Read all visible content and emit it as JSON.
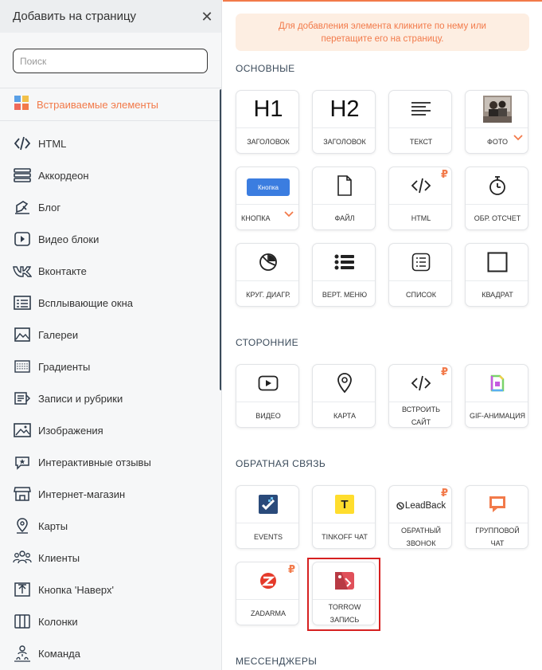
{
  "left_panel": {
    "title": "Добавить на страницу",
    "search_placeholder": "Поиск",
    "embedded_label": "Встраиваемые элементы",
    "items": [
      {
        "label": "HTML",
        "icon": "code-icon"
      },
      {
        "label": "Аккордеон",
        "icon": "accordion-icon"
      },
      {
        "label": "Блог",
        "icon": "blog-icon"
      },
      {
        "label": "Видео блоки",
        "icon": "video-icon"
      },
      {
        "label": "Вконтакте",
        "icon": "vk-icon"
      },
      {
        "label": "Всплывающие окна",
        "icon": "popup-icon"
      },
      {
        "label": "Галереи",
        "icon": "gallery-icon"
      },
      {
        "label": "Градиенты",
        "icon": "gradient-icon"
      },
      {
        "label": "Записи и рубрики",
        "icon": "posts-icon"
      },
      {
        "label": "Изображения",
        "icon": "image-icon"
      },
      {
        "label": "Интерактивные отзывы",
        "icon": "reviews-icon"
      },
      {
        "label": "Интернет-магазин",
        "icon": "shop-icon"
      },
      {
        "label": "Карты",
        "icon": "map-pin-icon"
      },
      {
        "label": "Клиенты",
        "icon": "clients-icon"
      },
      {
        "label": "Кнопка 'Наверх'",
        "icon": "scroll-top-icon"
      },
      {
        "label": "Колонки",
        "icon": "columns-icon"
      },
      {
        "label": "Команда",
        "icon": "team-icon"
      }
    ]
  },
  "right_panel": {
    "hint": "Для добавления элемента кликните по нему или перетащите его на страницу.",
    "sections": {
      "basic": "ОСНОВНЫЕ",
      "third_party": "СТОРОННИЕ",
      "feedback": "ОБРАТНАЯ СВЯЗЬ",
      "messengers": "МЕССЕНДЖЕРЫ"
    },
    "basic_cards": {
      "h1": {
        "icon_text": "H1",
        "label": "ЗАГОЛОВОК"
      },
      "h2": {
        "icon_text": "H2",
        "label": "ЗАГОЛОВОК"
      },
      "text": {
        "label": "ТЕКСТ"
      },
      "photo": {
        "label": "ФОТО"
      },
      "button": {
        "button_text": "Кнопка",
        "label": "КНОПКА"
      },
      "file": {
        "label": "ФАЙЛ"
      },
      "html": {
        "label": "HTML",
        "badge": "₽"
      },
      "countdown": {
        "label": "ОБР. ОТСЧЕТ"
      },
      "pie": {
        "label": "КРУГ. ДИАГР."
      },
      "vmenu": {
        "label": "ВЕРТ. МЕНЮ"
      },
      "list": {
        "label": "СПИСОК"
      },
      "square": {
        "label": "КВАДРАТ"
      }
    },
    "third_party_cards": {
      "video": {
        "label": "ВИДЕО"
      },
      "map": {
        "label": "КАРТА"
      },
      "embed": {
        "label": "ВСТРОИТЬ САЙТ",
        "badge": "₽"
      },
      "gif": {
        "label": "GIF-АНИМАЦИЯ"
      }
    },
    "feedback_cards": {
      "events": {
        "label": "EVENTS"
      },
      "tinkoff": {
        "label": "TINKOFF ЧАТ",
        "logo_text": "T"
      },
      "leadback": {
        "label": "ОБРАТНЫЙ ЗВОНОК",
        "logo_text": "LeadBack",
        "badge": "₽"
      },
      "group_chat": {
        "label": "ГРУППОВОЙ ЧАТ"
      },
      "zadarma": {
        "label": "ZADARMA",
        "badge": "₽"
      },
      "torrow": {
        "label": "TORROW ЗАПИСЬ"
      }
    },
    "colors": {
      "accent": "#f27a4a",
      "highlight": "#d62020",
      "tinkoff": "#ffdd2d",
      "events": "#2a4a7a",
      "torrow": "#e0505a"
    }
  }
}
